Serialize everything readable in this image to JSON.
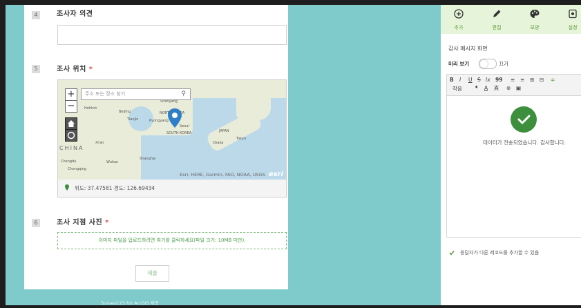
{
  "form": {
    "q4": {
      "num": "4",
      "title": "조사자 의견"
    },
    "q5": {
      "num": "5",
      "title": "조사 위치",
      "required": "*"
    },
    "q6": {
      "num": "6",
      "title": "조사 지점 사진",
      "required": "*"
    },
    "map": {
      "search_placeholder": "주소 또는 장소 찾기",
      "zoom_in": "+",
      "zoom_out": "−",
      "labels": {
        "shenyang": "Shenyang",
        "beijing": "Beijing",
        "tianjin": "Tianjin",
        "pyongyang": "Pyongyang",
        "seoul": "Seoul",
        "north_korea": "NORTH KOREA",
        "south_korea": "SOUTH KOREA",
        "japan": "JAPAN",
        "osaka": "Osaka",
        "tokyo": "Tokyo",
        "xian": "Xi'an",
        "china": "CHINA",
        "chengdu": "Chengdu",
        "wuhan": "Wuhan",
        "shanghai": "Shanghai",
        "chongqing": "Chongqing",
        "mongolia": "Hohhot"
      },
      "attribution": "Esri, HERE, Garmin, FAO, NOAA, USGS",
      "esri_logo": "esri"
    },
    "coords": "위도: 37.47581 경도: 126.69434",
    "upload_text": "이미지 파일을 업로드하려면 여기를 클릭하세요(파일 크기: 10MB 미만).",
    "submit_label": "제출",
    "footer": "Survey123 for ArcGIS 제공"
  },
  "panel": {
    "tools": [
      {
        "label": "추가",
        "icon": "plus-circle-icon"
      },
      {
        "label": "편집",
        "icon": "pencil-icon"
      },
      {
        "label": "모양",
        "icon": "palette-icon"
      },
      {
        "label": "설정",
        "icon": "settings-icon"
      }
    ],
    "title": "감사 메시지 화면",
    "preview_label": "미리 보기",
    "toggle_label": "끄기",
    "editor_toolbar": {
      "row1": [
        "B",
        "I",
        "U",
        "S",
        "Ix",
        "99",
        "≡",
        "≡",
        "⊞",
        "⊟",
        "≑"
      ],
      "row2": [
        "작음",
        "A",
        "A",
        "⊗",
        "▣"
      ]
    },
    "message": "데이터가 전송되었습니다. 감사합니다.",
    "checkbox_label": "응답자가 다른 레코드를 추가할 수 있음"
  },
  "colors": {
    "canvas": "#7fcbcb",
    "accent_green": "#5d9a3a",
    "toolbar_bg": "#e6f4d9",
    "success_green": "#3d8f3d",
    "required_red": "#d9534f"
  }
}
